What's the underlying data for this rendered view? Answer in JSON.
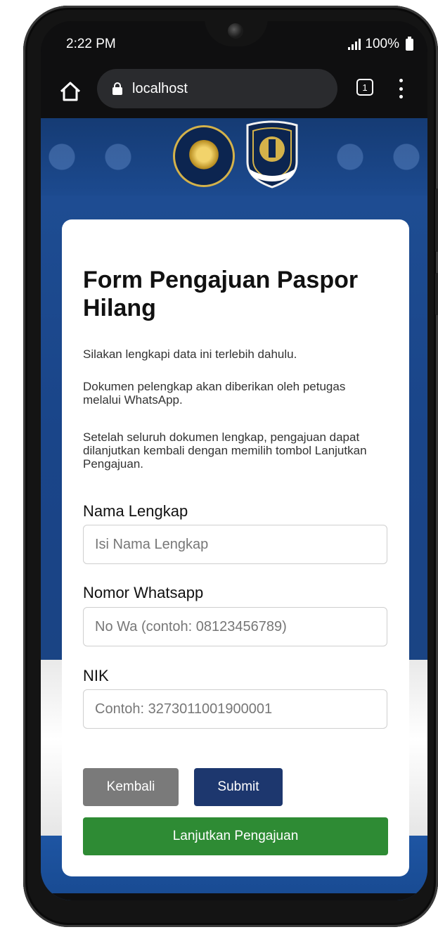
{
  "status_bar": {
    "time": "2:22 PM",
    "battery": "100%"
  },
  "browser": {
    "url": "localhost",
    "tab_count": "1"
  },
  "form": {
    "title": "Form Pengajuan Paspor Hilang",
    "intro": [
      "Silakan lengkapi data ini terlebih dahulu.",
      "Dokumen pelengkap akan diberikan oleh petugas melalui WhatsApp.",
      "Setelah seluruh dokumen lengkap, pengajuan dapat dilanjutkan kembali dengan memilih tombol Lanjutkan Pengajuan."
    ],
    "fields": [
      {
        "label": "Nama Lengkap",
        "placeholder": "Isi Nama Lengkap"
      },
      {
        "label": "Nomor Whatsapp",
        "placeholder": "No Wa (contoh: 08123456789)"
      },
      {
        "label": "NIK",
        "placeholder": "Contoh: 3273011001900001"
      }
    ],
    "buttons": {
      "back": "Kembali",
      "submit": "Submit",
      "continue": "Lanjutkan Pengajuan"
    }
  },
  "colors": {
    "page_blue": "#1f4f95",
    "back_button": "#7a7a7a",
    "submit_button": "#1d376e",
    "continue_button": "#2e8b34"
  },
  "icons": [
    "home-icon",
    "lock-icon",
    "tabs-icon",
    "more-menu-icon",
    "signal-icon",
    "battery-icon",
    "garuda-emblem-icon",
    "imigrasi-emblem-icon"
  ]
}
